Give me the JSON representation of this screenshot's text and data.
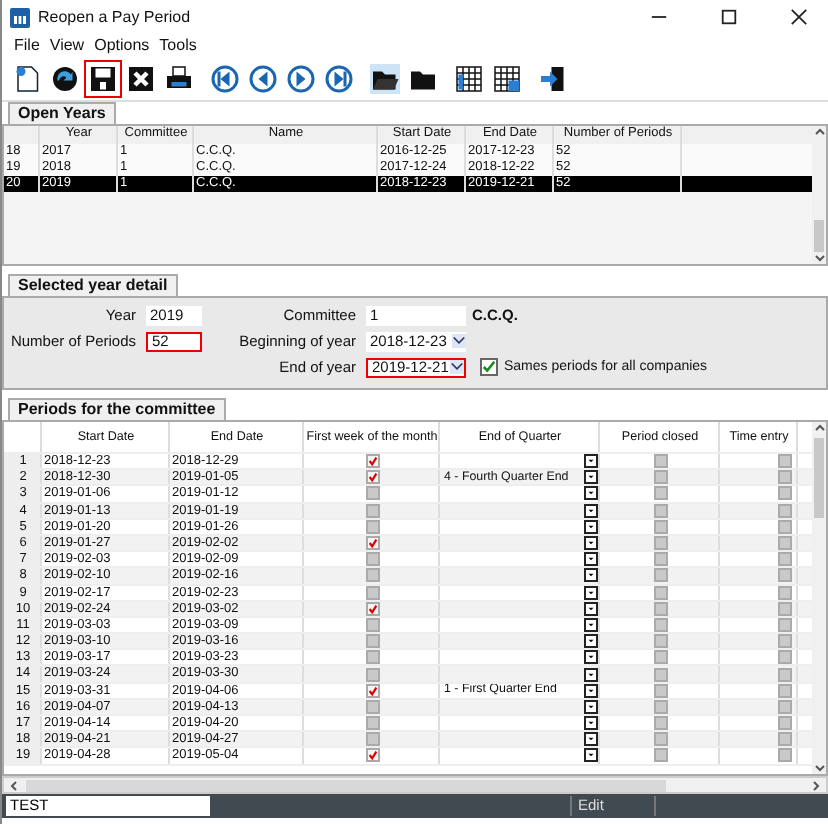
{
  "window": {
    "title": "Reopen a Pay Period"
  },
  "menu": [
    "File",
    "View",
    "Options",
    "Tools"
  ],
  "toolbar": [
    {
      "kind": "new",
      "highlighted": false
    },
    {
      "kind": "refresh",
      "highlighted": false
    },
    {
      "kind": "save",
      "highlighted": true
    },
    {
      "kind": "delete",
      "highlighted": false
    },
    {
      "kind": "print",
      "highlighted": false
    },
    {
      "kind": "first",
      "highlighted": false
    },
    {
      "kind": "prev",
      "highlighted": false
    },
    {
      "kind": "next",
      "highlighted": false
    },
    {
      "kind": "last",
      "highlighted": false
    },
    {
      "kind": "open",
      "highlighted": false
    },
    {
      "kind": "folder",
      "highlighted": false
    },
    {
      "kind": "grid",
      "highlighted": false
    },
    {
      "kind": "gridlock",
      "highlighted": false
    },
    {
      "kind": "exit",
      "highlighted": false
    }
  ],
  "open_years": {
    "tab": "Open Years",
    "columns": [
      "Year",
      "Committee",
      "Name",
      "Start Date",
      "End Date",
      "Number of Periods"
    ],
    "rows": [
      {
        "num": "18",
        "cells": [
          "2017",
          "1",
          "C.C.Q.",
          "2016-12-25",
          "2017-12-23",
          "52"
        ],
        "selected": false
      },
      {
        "num": "19",
        "cells": [
          "2018",
          "1",
          "C.C.Q.",
          "2017-12-24",
          "2018-12-22",
          "52"
        ],
        "selected": false
      },
      {
        "num": "20",
        "cells": [
          "2019",
          "1",
          "C.C.Q.",
          "2018-12-23",
          "2019-12-21",
          "52"
        ],
        "selected": true
      }
    ]
  },
  "detail": {
    "tab": "Selected year detail",
    "year": {
      "label": "Year",
      "value": "2019",
      "highlighted": false
    },
    "periods": {
      "label": "Number of Periods",
      "value": "52",
      "highlighted": true
    },
    "committee": {
      "label": "Committee",
      "value": "1",
      "name": "C.C.Q.",
      "highlighted": false
    },
    "beginning": {
      "label": "Beginning of year",
      "value": "2018-12-23",
      "highlighted": false
    },
    "end": {
      "label": "End of year",
      "value": "2019-12-21",
      "highlighted": true
    },
    "same_periods": {
      "label": "Sames periods for all companies",
      "checked": true
    }
  },
  "periods": {
    "tab": "Periods for the committee",
    "columns": [
      "Start Date",
      "End Date",
      "First week of the month",
      "End of Quarter",
      "Period closed",
      "Time entry"
    ],
    "rows": [
      {
        "num": "1",
        "start": "2018-12-23",
        "end": "2018-12-29",
        "first_week": true,
        "quarter": "",
        "closed": false,
        "time_entry": false
      },
      {
        "num": "2",
        "start": "2018-12-30",
        "end": "2019-01-05",
        "first_week": true,
        "quarter": "4 - Fourth Quarter End",
        "closed": false,
        "time_entry": false
      },
      {
        "num": "3",
        "start": "2019-01-06",
        "end": "2019-01-12",
        "first_week": false,
        "quarter": "",
        "closed": false,
        "time_entry": false
      },
      {
        "num": "4",
        "start": "2019-01-13",
        "end": "2019-01-19",
        "first_week": false,
        "quarter": "",
        "closed": false,
        "time_entry": false
      },
      {
        "num": "5",
        "start": "2019-01-20",
        "end": "2019-01-26",
        "first_week": false,
        "quarter": "",
        "closed": false,
        "time_entry": false
      },
      {
        "num": "6",
        "start": "2019-01-27",
        "end": "2019-02-02",
        "first_week": true,
        "quarter": "",
        "closed": false,
        "time_entry": false
      },
      {
        "num": "7",
        "start": "2019-02-03",
        "end": "2019-02-09",
        "first_week": false,
        "quarter": "",
        "closed": false,
        "time_entry": false
      },
      {
        "num": "8",
        "start": "2019-02-10",
        "end": "2019-02-16",
        "first_week": false,
        "quarter": "",
        "closed": false,
        "time_entry": false
      },
      {
        "num": "9",
        "start": "2019-02-17",
        "end": "2019-02-23",
        "first_week": false,
        "quarter": "",
        "closed": false,
        "time_entry": false
      },
      {
        "num": "10",
        "start": "2019-02-24",
        "end": "2019-03-02",
        "first_week": true,
        "quarter": "",
        "closed": false,
        "time_entry": false
      },
      {
        "num": "11",
        "start": "2019-03-03",
        "end": "2019-03-09",
        "first_week": false,
        "quarter": "",
        "closed": false,
        "time_entry": false
      },
      {
        "num": "12",
        "start": "2019-03-10",
        "end": "2019-03-16",
        "first_week": false,
        "quarter": "",
        "closed": false,
        "time_entry": false
      },
      {
        "num": "13",
        "start": "2019-03-17",
        "end": "2019-03-23",
        "first_week": false,
        "quarter": "",
        "closed": false,
        "time_entry": false
      },
      {
        "num": "14",
        "start": "2019-03-24",
        "end": "2019-03-30",
        "first_week": false,
        "quarter": "",
        "closed": false,
        "time_entry": false
      },
      {
        "num": "15",
        "start": "2019-03-31",
        "end": "2019-04-06",
        "first_week": true,
        "quarter": "1 - First Quarter End",
        "closed": false,
        "time_entry": false
      },
      {
        "num": "16",
        "start": "2019-04-07",
        "end": "2019-04-13",
        "first_week": false,
        "quarter": "",
        "closed": false,
        "time_entry": false
      },
      {
        "num": "17",
        "start": "2019-04-14",
        "end": "2019-04-20",
        "first_week": false,
        "quarter": "",
        "closed": false,
        "time_entry": false
      },
      {
        "num": "18",
        "start": "2019-04-21",
        "end": "2019-04-27",
        "first_week": false,
        "quarter": "",
        "closed": false,
        "time_entry": false
      },
      {
        "num": "19",
        "start": "2019-04-28",
        "end": "2019-05-04",
        "first_week": true,
        "quarter": "",
        "closed": false,
        "time_entry": false
      }
    ]
  },
  "status_bar": {
    "field": "TEST",
    "mode": "Edit"
  }
}
